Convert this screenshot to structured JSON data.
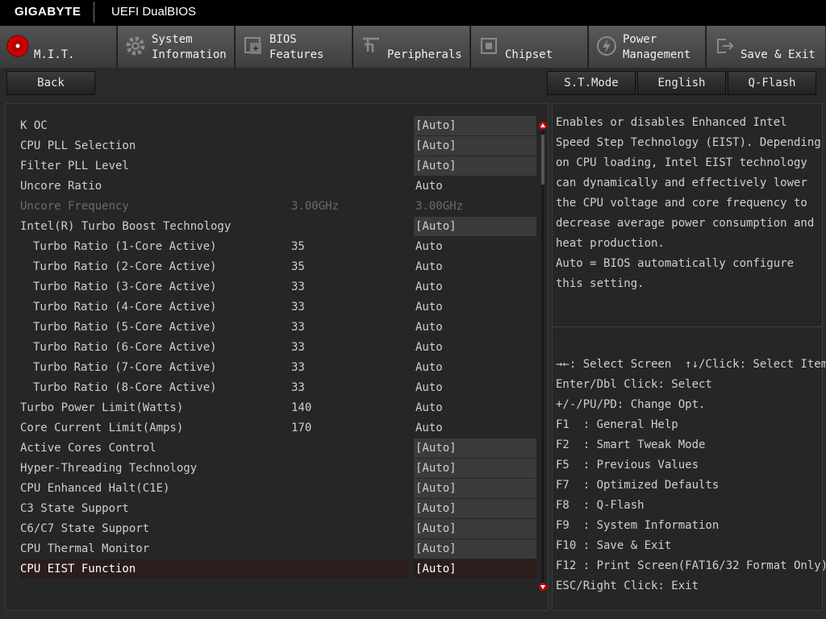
{
  "header": {
    "brand": "GIGABYTE",
    "product": "UEFI DualBIOS"
  },
  "tabs": [
    {
      "line1": "M.I.T.",
      "line2": "",
      "icon": "mit-icon",
      "active": true
    },
    {
      "line1": "System",
      "line2": "Information",
      "icon": "gear-icon"
    },
    {
      "line1": "BIOS",
      "line2": "Features",
      "icon": "bios-features-icon"
    },
    {
      "line1": "Peripherals",
      "line2": "",
      "icon": "peripherals-icon"
    },
    {
      "line1": "Chipset",
      "line2": "",
      "icon": "chipset-icon"
    },
    {
      "line1": "Power",
      "line2": "Management",
      "icon": "power-icon"
    },
    {
      "line1": "Save & Exit",
      "line2": "",
      "icon": "exit-icon"
    }
  ],
  "commands": {
    "back": "Back",
    "stmode": "S.T.Mode",
    "language": "English",
    "qflash": "Q-Flash"
  },
  "settings": [
    {
      "name": "K OC",
      "current": "",
      "value": "[Auto]"
    },
    {
      "name": "CPU PLL Selection",
      "current": "",
      "value": "[Auto]"
    },
    {
      "name": "Filter PLL Level",
      "current": "",
      "value": "[Auto]"
    },
    {
      "name": "Uncore Ratio",
      "current": "",
      "value": "Auto"
    },
    {
      "name": "Uncore Frequency",
      "current": "3.00GHz",
      "value": "3.00GHz"
    },
    {
      "name": "Intel(R) Turbo Boost Technology",
      "current": "",
      "value": "[Auto]"
    },
    {
      "name": "Turbo Ratio (1-Core Active)",
      "current": "35",
      "value": "Auto"
    },
    {
      "name": "Turbo Ratio (2-Core Active)",
      "current": "35",
      "value": "Auto"
    },
    {
      "name": "Turbo Ratio (3-Core Active)",
      "current": "33",
      "value": "Auto"
    },
    {
      "name": "Turbo Ratio (4-Core Active)",
      "current": "33",
      "value": "Auto"
    },
    {
      "name": "Turbo Ratio (5-Core Active)",
      "current": "33",
      "value": "Auto"
    },
    {
      "name": "Turbo Ratio (6-Core Active)",
      "current": "33",
      "value": "Auto"
    },
    {
      "name": "Turbo Ratio (7-Core Active)",
      "current": "33",
      "value": "Auto"
    },
    {
      "name": "Turbo Ratio (8-Core Active)",
      "current": "33",
      "value": "Auto"
    },
    {
      "name": "Turbo Power Limit(Watts)",
      "current": "140",
      "value": "Auto"
    },
    {
      "name": "Core Current Limit(Amps)",
      "current": "170",
      "value": "Auto"
    },
    {
      "name": "Active Cores Control",
      "current": "",
      "value": "[Auto]"
    },
    {
      "name": "Hyper-Threading Technology",
      "current": "",
      "value": "[Auto]"
    },
    {
      "name": "CPU Enhanced Halt(C1E)",
      "current": "",
      "value": "[Auto]"
    },
    {
      "name": "C3 State Support",
      "current": "",
      "value": "[Auto]"
    },
    {
      "name": "C6/C7 State Support",
      "current": "",
      "value": "[Auto]"
    },
    {
      "name": "CPU Thermal Monitor",
      "current": "",
      "value": "[Auto]"
    },
    {
      "name": "CPU EIST Function",
      "current": "",
      "value": "[Auto]"
    }
  ],
  "help": {
    "description": [
      "Enables or disables Enhanced Intel",
      "Speed Step Technology (EIST). Depending",
      "on CPU loading, Intel EIST technology",
      "can dynamically and effectively lower",
      "the CPU voltage and core frequency to",
      "decrease average power consumption and",
      "heat production.",
      "Auto = BIOS automatically configure",
      "this setting."
    ],
    "keys": [
      "→←: Select Screen  ↑↓/Click: Select Item",
      "Enter/Dbl Click: Select",
      "+/-/PU/PD: Change Opt.",
      "F1  : General Help",
      "F2  : Smart Tweak Mode",
      "F5  : Previous Values",
      "F7  : Optimized Defaults",
      "F8  : Q-Flash",
      "F9  : System Information",
      "F10 : Save & Exit",
      "F12 : Print Screen(FAT16/32 Format Only)",
      "ESC/Right Click: Exit"
    ]
  },
  "colors": {
    "accent": "#cc0000",
    "selected_row": "#2a1d1b",
    "dim_text": "#6b6b6b"
  }
}
